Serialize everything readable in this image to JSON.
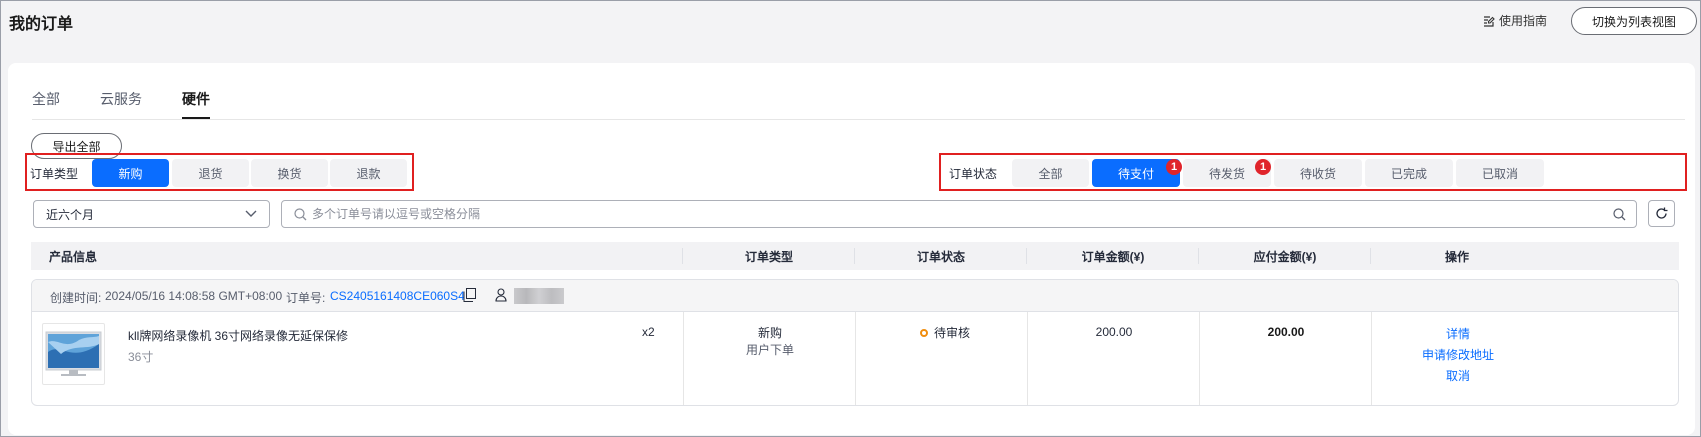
{
  "header": {
    "title": "我的订单",
    "guide_label": "使用指南",
    "switch_label": "切换为列表视图"
  },
  "tabs": [
    {
      "label": "全部",
      "active": false
    },
    {
      "label": "云服务",
      "active": false
    },
    {
      "label": "硬件",
      "active": true
    }
  ],
  "toolbar": {
    "export_label": "导出全部"
  },
  "order_type_filter": {
    "label": "订单类型",
    "options": [
      "新购",
      "退货",
      "换货",
      "退款"
    ],
    "selected": "新购"
  },
  "order_status_filter": {
    "label": "订单状态",
    "options": [
      "全部",
      "待支付",
      "待发货",
      "待收货",
      "已完成",
      "已取消"
    ],
    "selected": "待支付",
    "badges": {
      "待支付": "1",
      "待发货": "1"
    }
  },
  "date_select": {
    "value": "近六个月"
  },
  "search": {
    "placeholder": "多个订单号请以逗号或空格分隔",
    "value": ""
  },
  "table": {
    "columns": [
      "产品信息",
      "订单类型",
      "订单状态",
      "订单金额(¥)",
      "应付金额(¥)",
      "操作"
    ]
  },
  "order": {
    "created_label": "创建时间:",
    "created_value": "2024/05/16 14:08:58 GMT+08:00",
    "order_no_label": "订单号:",
    "order_no": "CS2405161408CE060S4",
    "product_name": "kll牌网络录像机 36寸网络录像无延保保修",
    "product_spec": "36寸",
    "quantity": "x2",
    "type": "新购",
    "type_sub": "用户下单",
    "status": "待审核",
    "amount": "200.00",
    "payable": "200.00",
    "actions": [
      "详情",
      "申请修改地址",
      "取消"
    ]
  },
  "colors": {
    "accent": "#0a6dff",
    "highlight_box": "#e02020",
    "badge": "#e0242b",
    "status_pending": "#f08d0e"
  }
}
